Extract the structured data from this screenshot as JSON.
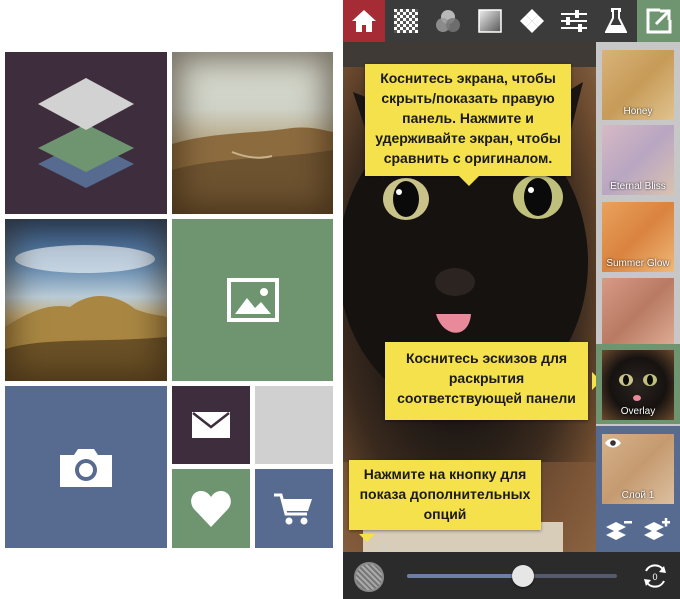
{
  "tooltips": {
    "top": [
      "Коснитесь экрана, чтобы",
      "скрыть/показать правую",
      "панель. Нажмите и",
      "удерживайте экран, чтобы",
      "сравнить с оригиналом."
    ],
    "thumbs": [
      "Коснитесь эскизов для",
      "раскрытия",
      "соответствующей панели"
    ],
    "button": [
      "Нажмите на кнопку для",
      "показа дополнительных",
      "опций"
    ]
  },
  "textures": [
    {
      "label": "Honey"
    },
    {
      "label": "Eternal Bliss"
    },
    {
      "label": "Summer Glow"
    },
    {
      "label": ""
    },
    {
      "label": "Overlay"
    },
    {
      "label": "Слой 1"
    }
  ],
  "toolbar_icons": [
    "home-icon",
    "checker-texture-icon",
    "circles-blend-icon",
    "gradient-square-icon",
    "diamond-icon",
    "sliders-icon",
    "flask-icon",
    "share-icon"
  ],
  "slider": {
    "value": 0.55
  },
  "colors": {
    "home": "#a52b34",
    "share": "#6f9570",
    "bubble": "#f5e14c",
    "plum": "#3e2d3d",
    "green": "#6f9570",
    "blue": "#566b8f"
  }
}
